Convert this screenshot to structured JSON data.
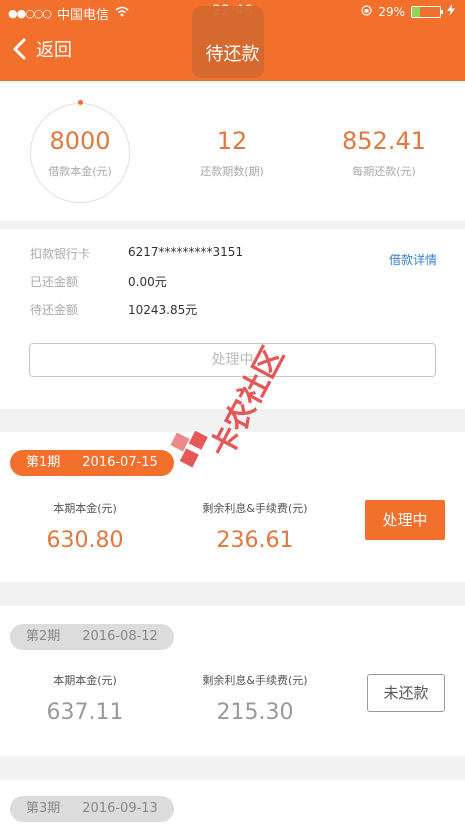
{
  "status_bar": {
    "carrier": "中国电信",
    "time": "22:46",
    "battery_percent": "29%",
    "battery_level": 0.29
  },
  "nav": {
    "back_label": "返回",
    "title": "待还款"
  },
  "summary": {
    "principal_value": "8000",
    "principal_label": "借款本金(元)",
    "terms_value": "12",
    "terms_label": "还款期数(期)",
    "per_term_value": "852.41",
    "per_term_label": "每期还款(元)"
  },
  "info": {
    "bank_card_label": "扣款银行卡",
    "bank_card_value": "6217*********3151",
    "repaid_label": "已还金额",
    "repaid_value": "0.00元",
    "pending_label": "待还金额",
    "pending_value": "10243.85元",
    "detail_link": "借款详情",
    "processing_button": "处理中"
  },
  "periods": [
    {
      "period_label": "第1期",
      "date": "2016-07-15",
      "principal_label": "本期本金(元)",
      "principal": "630.80",
      "interest_label": "剩余利息&手续费(元)",
      "interest": "236.61",
      "status": "处理中"
    },
    {
      "period_label": "第2期",
      "date": "2016-08-12",
      "principal_label": "本期本金(元)",
      "principal": "637.11",
      "interest_label": "剩余利息&手续费(元)",
      "interest": "215.30",
      "status": "未还款"
    },
    {
      "period_label": "第3期",
      "date": "2016-09-13"
    }
  ],
  "watermark": {
    "text": "卡农社区"
  }
}
